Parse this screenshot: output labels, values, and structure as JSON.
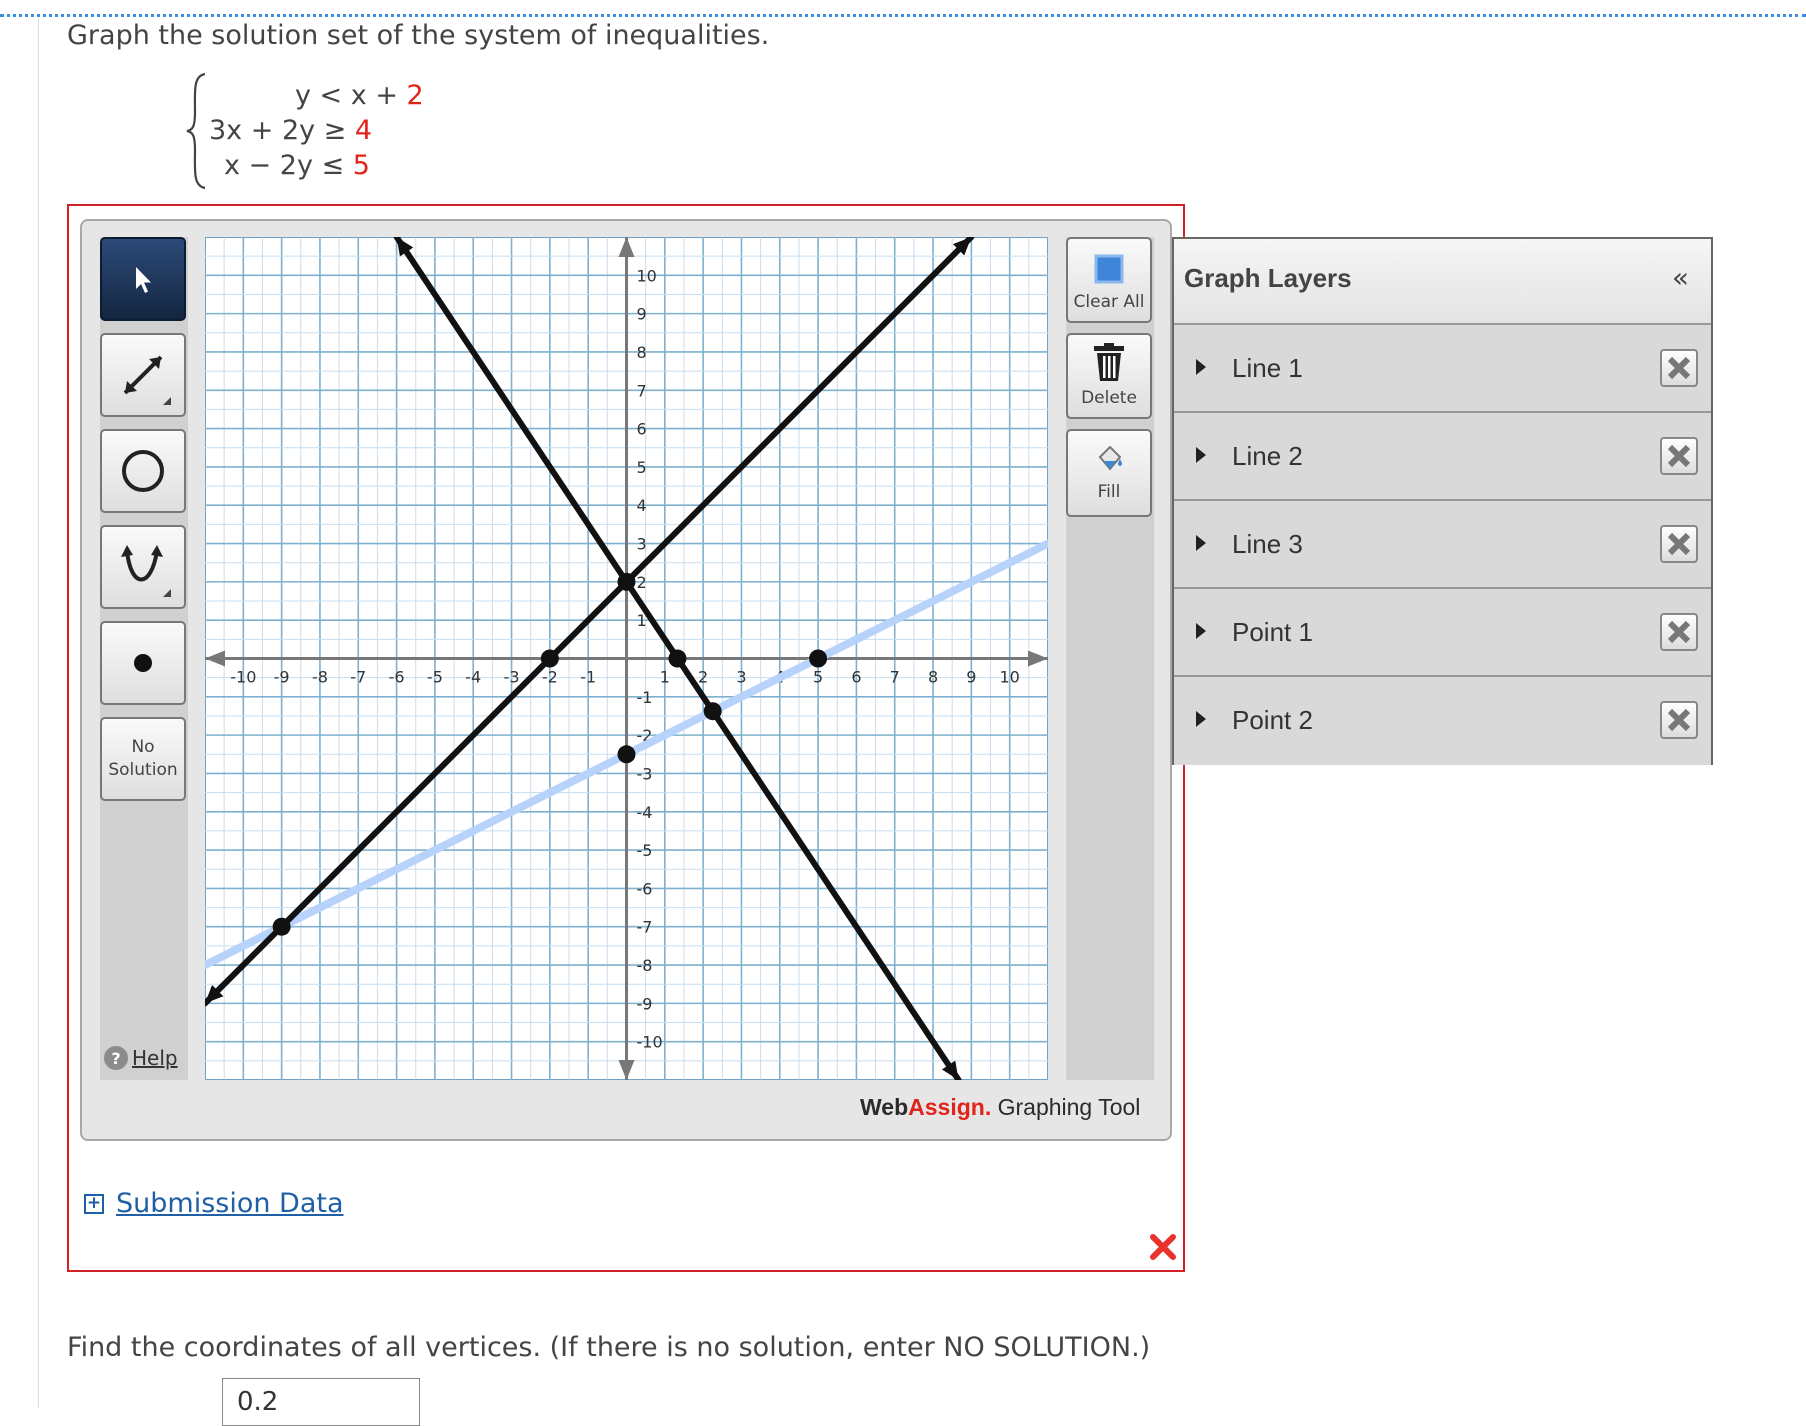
{
  "question": {
    "prompt": "Graph the solution set of the system of inequalities.",
    "system": [
      {
        "lhs": "y < x + ",
        "rhs": "2"
      },
      {
        "lhs": "3x + 2y ≥ ",
        "rhs": "4"
      },
      {
        "lhs": "x − 2y ≤ ",
        "rhs": "5"
      }
    ]
  },
  "toolbar": {
    "tools": [
      "pointer-tool",
      "line-tool",
      "circle-tool",
      "parabola-tool",
      "point-tool"
    ],
    "no_solution": "No Solution",
    "help": "Help"
  },
  "side": {
    "clear_all": "Clear All",
    "delete": "Delete",
    "fill": "Fill"
  },
  "brand": {
    "web": "Web",
    "assign": "Assign.",
    "tool": " Graphing Tool"
  },
  "graph": {
    "xmin": -11,
    "xmax": 11,
    "ymin": -11,
    "ymax": 11,
    "x_ticks": [
      "-10",
      "-9",
      "-8",
      "-7",
      "-6",
      "-5",
      "-4",
      "-3",
      "-2",
      "-1",
      "1",
      "2",
      "3",
      "4",
      "5",
      "6",
      "7",
      "8",
      "9",
      "10"
    ],
    "y_ticks": [
      "10",
      "9",
      "8",
      "7",
      "6",
      "5",
      "4",
      "3",
      "2",
      "1",
      "-1",
      "-2",
      "-3",
      "-4",
      "-5",
      "-6",
      "-7",
      "-8",
      "-9",
      "-10"
    ],
    "lines": [
      {
        "name": "Line 1",
        "type": "y = x + 2",
        "color": "#111111"
      },
      {
        "name": "Line 2",
        "type": "3x + 2y = 4",
        "color": "#111111"
      },
      {
        "name": "Line 3",
        "type": "x - 2y = 5",
        "color": "#b8d3fb"
      }
    ],
    "points": [
      {
        "x": -2,
        "y": 0
      },
      {
        "x": 0,
        "y": 2
      },
      {
        "x": 1.33,
        "y": 0
      },
      {
        "x": 5,
        "y": 0
      },
      {
        "x": 0,
        "y": -2.5
      },
      {
        "x": 2.25,
        "y": -1.375
      },
      {
        "x": -9,
        "y": -7
      }
    ]
  },
  "layers": {
    "title": "Graph Layers",
    "collapse": "«",
    "items": [
      "Line 1",
      "Line 2",
      "Line 3",
      "Point 1",
      "Point 2"
    ]
  },
  "submission": {
    "label": "Submission Data"
  },
  "find": {
    "text": "Find the coordinates of all vertices. (If there is no solution, enter NO SOLUTION.)",
    "answer_value": "0.2"
  }
}
